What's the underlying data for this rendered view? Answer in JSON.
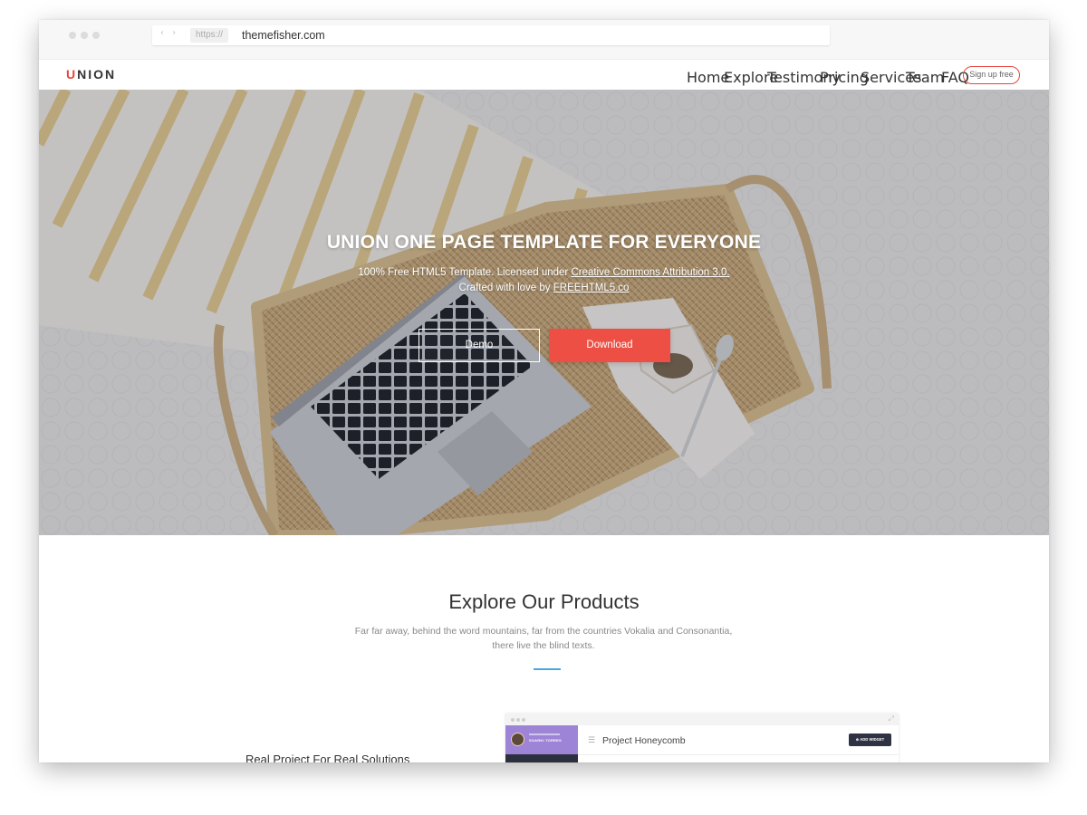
{
  "browser": {
    "protocol": "https://",
    "host": "themefisher.com",
    "nav_arrows": "‹ ›"
  },
  "site": {
    "logo_accent": "U",
    "logo_rest": "NION",
    "nav": {
      "items": [
        "Home",
        "Explore",
        "Testimony",
        "Pricing",
        "Services",
        "Team",
        "FAQ"
      ],
      "active": "Home",
      "signup": "Sign up free"
    }
  },
  "hero": {
    "title": "UNION ONE PAGE TEMPLATE FOR EVERYONE",
    "subtitle_prefix": "100% Free HTML5 Template. Licensed under ",
    "license_link": "Creative Commons Attribution 3.0.",
    "crafted_prefix": "Crafted with love by ",
    "crafted_link": "FREEHTML5.co",
    "buttons": {
      "demo": "Demo",
      "download": "Download"
    }
  },
  "explore": {
    "title": "Explore Our Products",
    "description": "Far far away, behind the word mountains, far from the countries Vokalia and Consonantia, there live the blind texts.",
    "feature_title": "Real Project For Real Solutions"
  },
  "mockup": {
    "user_name": "SOARKI TORRES",
    "project_icon": "☰",
    "project_title": "Project Honeycomb",
    "add_widget": "⊕ ADD WIDGET",
    "expand_icon": "⤢"
  },
  "colors": {
    "accent": "#e8453c",
    "download_button": "#ee4f44",
    "divider_blue": "#4aa8e0",
    "mock_sidebar": "#2c2f3d",
    "mock_profile": "#9d84d6"
  }
}
